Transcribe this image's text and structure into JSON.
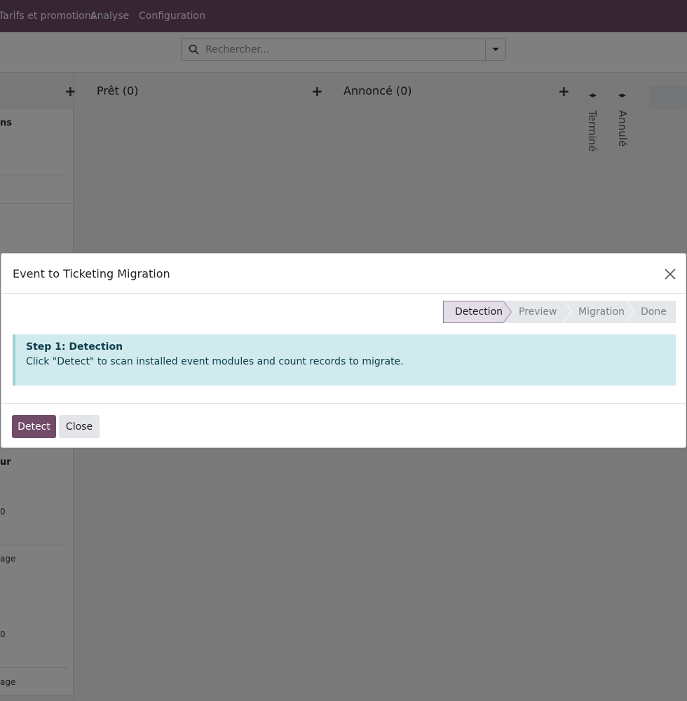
{
  "navbar": {
    "items": [
      "Tarifs et promotions",
      "Analyse",
      "Configuration"
    ]
  },
  "search": {
    "placeholder": "Rechercher..."
  },
  "kanban": {
    "columns": [
      {
        "title": "Prêt (0)"
      },
      {
        "title": "Annoncé (0)"
      }
    ],
    "folded": [
      "Terminé",
      "Annulé"
    ],
    "left_cards": {
      "c1_title": "ns",
      "c2_title": "ur",
      "c2_value": "0",
      "c2_footer": "age",
      "c3_value": "0",
      "c3_footer": "age"
    }
  },
  "modal": {
    "title": "Event to Ticketing Migration",
    "stages": [
      "Detection",
      "Preview",
      "Migration",
      "Done"
    ],
    "active_stage": "Detection",
    "alert_title": "Step 1: Detection",
    "alert_text": "Click \"Detect\" to scan installed event modules and count records to migrate.",
    "detect_label": "Detect",
    "close_label": "Close"
  },
  "colors": {
    "brand": "#714b67",
    "alert_bg": "#d1eaee"
  }
}
